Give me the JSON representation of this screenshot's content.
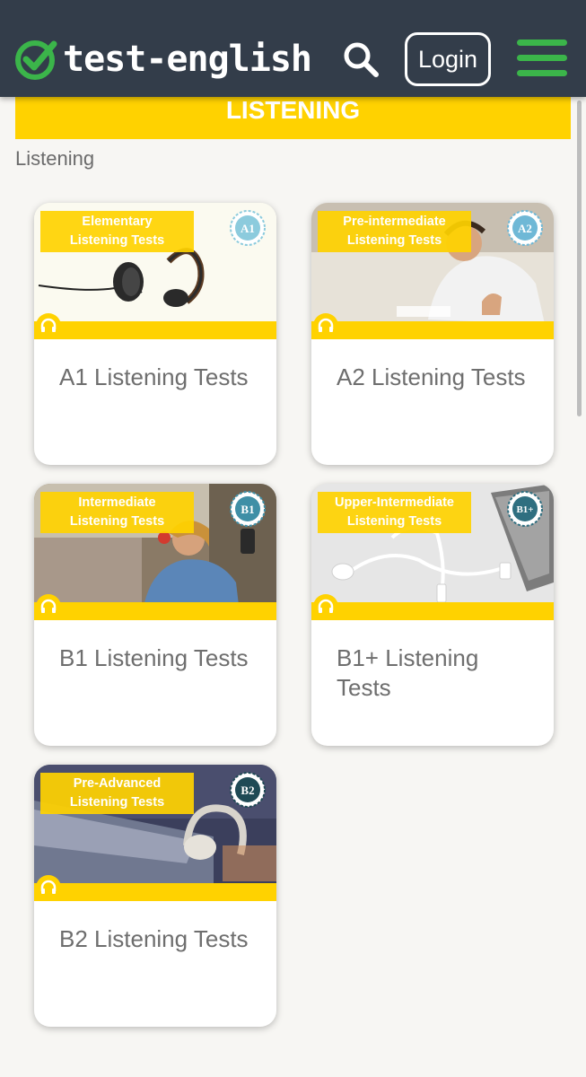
{
  "header": {
    "logo_text": "test-english",
    "login_label": "Login",
    "icons": [
      "check-circle-icon",
      "search-icon",
      "hamburger-menu-icon"
    ],
    "colors": {
      "background": "#333d4a",
      "accent_green": "#3bb54a"
    }
  },
  "banner": {
    "title": "LISTENING",
    "color": "#ffd200"
  },
  "breadcrumb": "Listening",
  "cards": [
    {
      "label_line1": "Elementary",
      "label_line2": "Listening Tests",
      "badge": "A1",
      "badge_color": "#8ccbdd",
      "title": "A1 Listening Tests"
    },
    {
      "label_line1": "Pre-intermediate",
      "label_line2": "Listening Tests",
      "badge": "A2",
      "badge_color": "#6fb8d6",
      "title": "A2 Listening Tests"
    },
    {
      "label_line1": "Intermediate",
      "label_line2": "Listening Tests",
      "badge": "B1",
      "badge_color": "#3f8fa6",
      "title": "B1 Listening Tests"
    },
    {
      "label_line1": "Upper-Intermediate",
      "label_line2": "Listening Tests",
      "badge": "B1+",
      "badge_color": "#2f6f80",
      "title": "B1+ Listening Tests"
    },
    {
      "label_line1": "Pre-Advanced",
      "label_line2": "Listening Tests",
      "badge": "B2",
      "badge_color": "#1f4a55",
      "title": "B2 Listening Tests"
    }
  ]
}
